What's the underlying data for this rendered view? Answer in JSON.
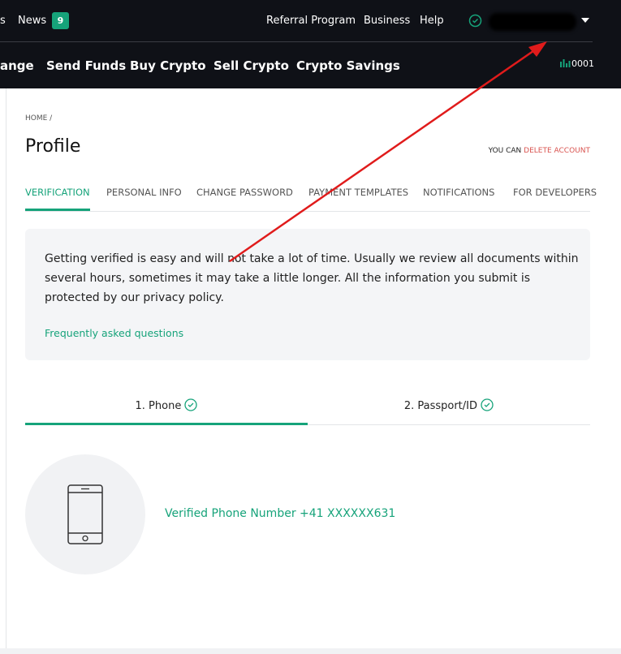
{
  "header": {
    "news_label": "News",
    "news_count": "9",
    "partial_left": "s",
    "links": [
      "Referral Program",
      "Business",
      "Help"
    ],
    "nav": [
      "ange",
      "Send Funds",
      "Buy Crypto",
      "Sell Crypto",
      "Crypto Savings"
    ],
    "account_code": "0001",
    "accent": "#16a37a"
  },
  "page": {
    "breadcrumb": "HOME /",
    "title": "Profile",
    "delete_prefix": "YOU CAN",
    "delete_link": "DELETE ACCOUNT",
    "tabs": [
      "VERIFICATION",
      "PERSONAL INFO",
      "CHANGE PASSWORD",
      "PAYMENT TEMPLATES",
      "NOTIFICATIONS",
      "FOR DEVELOPERS"
    ],
    "info_text": "Getting verified is easy and will not take a lot of time. Usually we review all documents within several hours, sometimes it may take a little longer. All the information you submit is protected by our privacy policy.",
    "faq_link": "Frequently asked questions",
    "steps": [
      "1. Phone",
      "2. Passport/ID"
    ],
    "verified_phone": "Verified Phone Number +41 XXXXXX631"
  }
}
